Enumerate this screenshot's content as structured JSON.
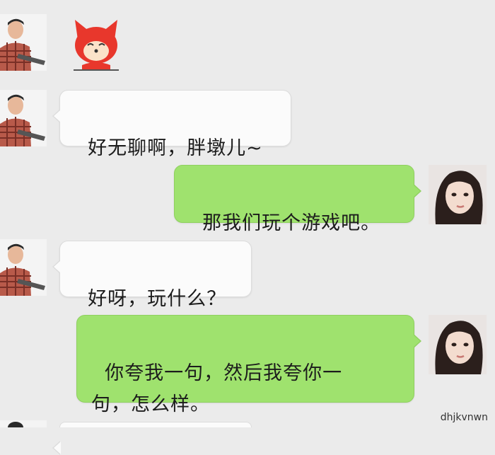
{
  "chat": {
    "messages": [
      {
        "side": "left",
        "sender": "male-avatar",
        "type": "sticker",
        "sticker": "red-fox-cartoon-sticker"
      },
      {
        "side": "left",
        "sender": "male-avatar",
        "type": "text",
        "text": "好无聊啊，胖墩儿~"
      },
      {
        "side": "right",
        "sender": "female-avatar",
        "type": "text",
        "text": "那我们玩个游戏吧。"
      },
      {
        "side": "left",
        "sender": "male-avatar",
        "type": "text",
        "text": "好呀，玩什么？"
      },
      {
        "side": "right",
        "sender": "female-avatar",
        "type": "text",
        "text": "你夸我一句，然后我夸你一\n句，怎么样。"
      }
    ]
  },
  "watermark": "dhjkvnwn",
  "colors": {
    "background": "#ebebeb",
    "bubble_left": "#fbfbfb",
    "bubble_right": "#9fe26e"
  }
}
